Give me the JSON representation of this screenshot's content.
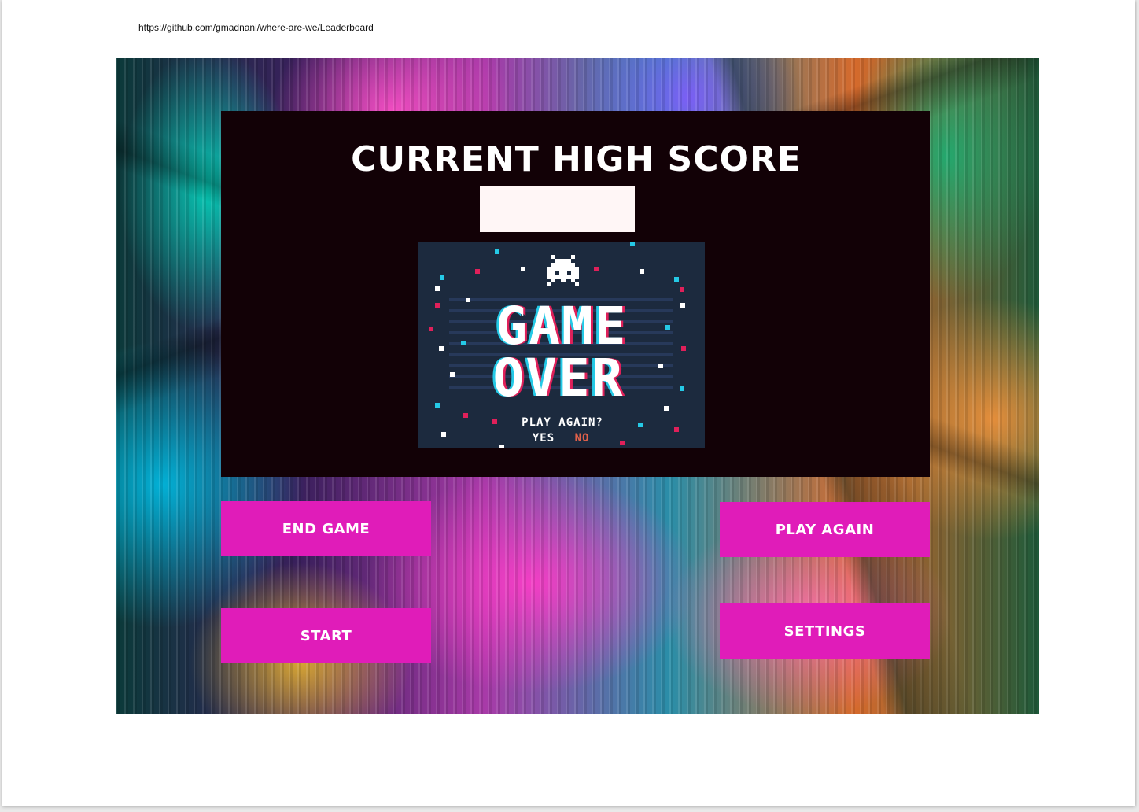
{
  "browser": {
    "url": "https://github.com/gmadnani/where-are-we/Leaderboard"
  },
  "panel": {
    "title": "CURRENT HIGH SCORE",
    "score_value": ""
  },
  "game_over_image": {
    "line1": "GAME",
    "line2": "OVER",
    "prompt": "PLAY AGAIN?",
    "yes": "YES",
    "no": "NO"
  },
  "buttons": {
    "end_game": "END GAME",
    "play_again": "PLAY AGAIN",
    "start": "START",
    "settings": "SETTINGS"
  },
  "colors": {
    "button": "#e01cb9",
    "panel": "#120106",
    "score_box": "#fff6f6",
    "game_over_bg": "#1c2a3e",
    "no_text": "#e0604a"
  }
}
